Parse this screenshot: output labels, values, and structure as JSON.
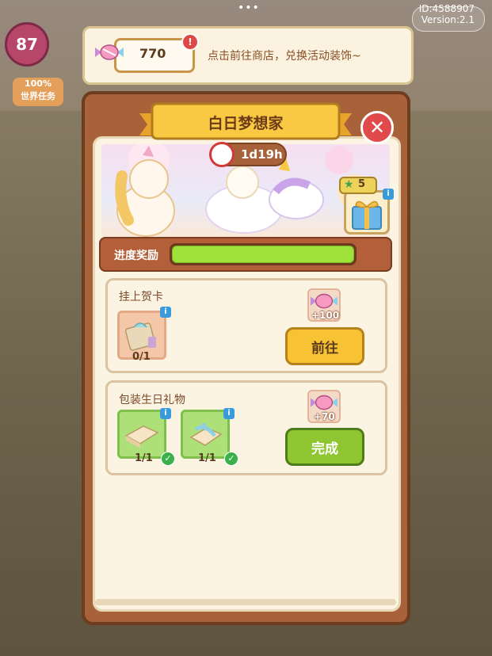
{
  "hud": {
    "level": "87",
    "world_task_pct": "100%",
    "world_task_label": "世界任务",
    "id_text": "ID:4588907",
    "version_text": "Version:2.1"
  },
  "topbar": {
    "candy_count": "770",
    "alert_mark": "!",
    "message": "点击前往商店，兑换活动装饰~"
  },
  "dialog": {
    "title": "白日梦想家",
    "close_glyph": "✕",
    "timer": "1d19h",
    "star_count": "5",
    "progress_label": "进度奖励",
    "progress_fraction": 1.0,
    "info_glyph": "i"
  },
  "tasks": [
    {
      "title": "挂上贺卡",
      "items": [
        {
          "count": "0/1",
          "done": false
        }
      ],
      "reward": "+100",
      "button": "前往"
    },
    {
      "title": "包装生日礼物",
      "items": [
        {
          "count": "1/1",
          "done": true
        },
        {
          "count": "1/1",
          "done": true
        }
      ],
      "reward": "+70",
      "button": "完成"
    }
  ],
  "check_glyph": "✓",
  "colors": {
    "dialog_frame": "#a8623a",
    "progress_fill": "#9ee23a",
    "go_button": "#f7c234",
    "done_button": "#8fc632",
    "close_button": "#e04a4a"
  }
}
